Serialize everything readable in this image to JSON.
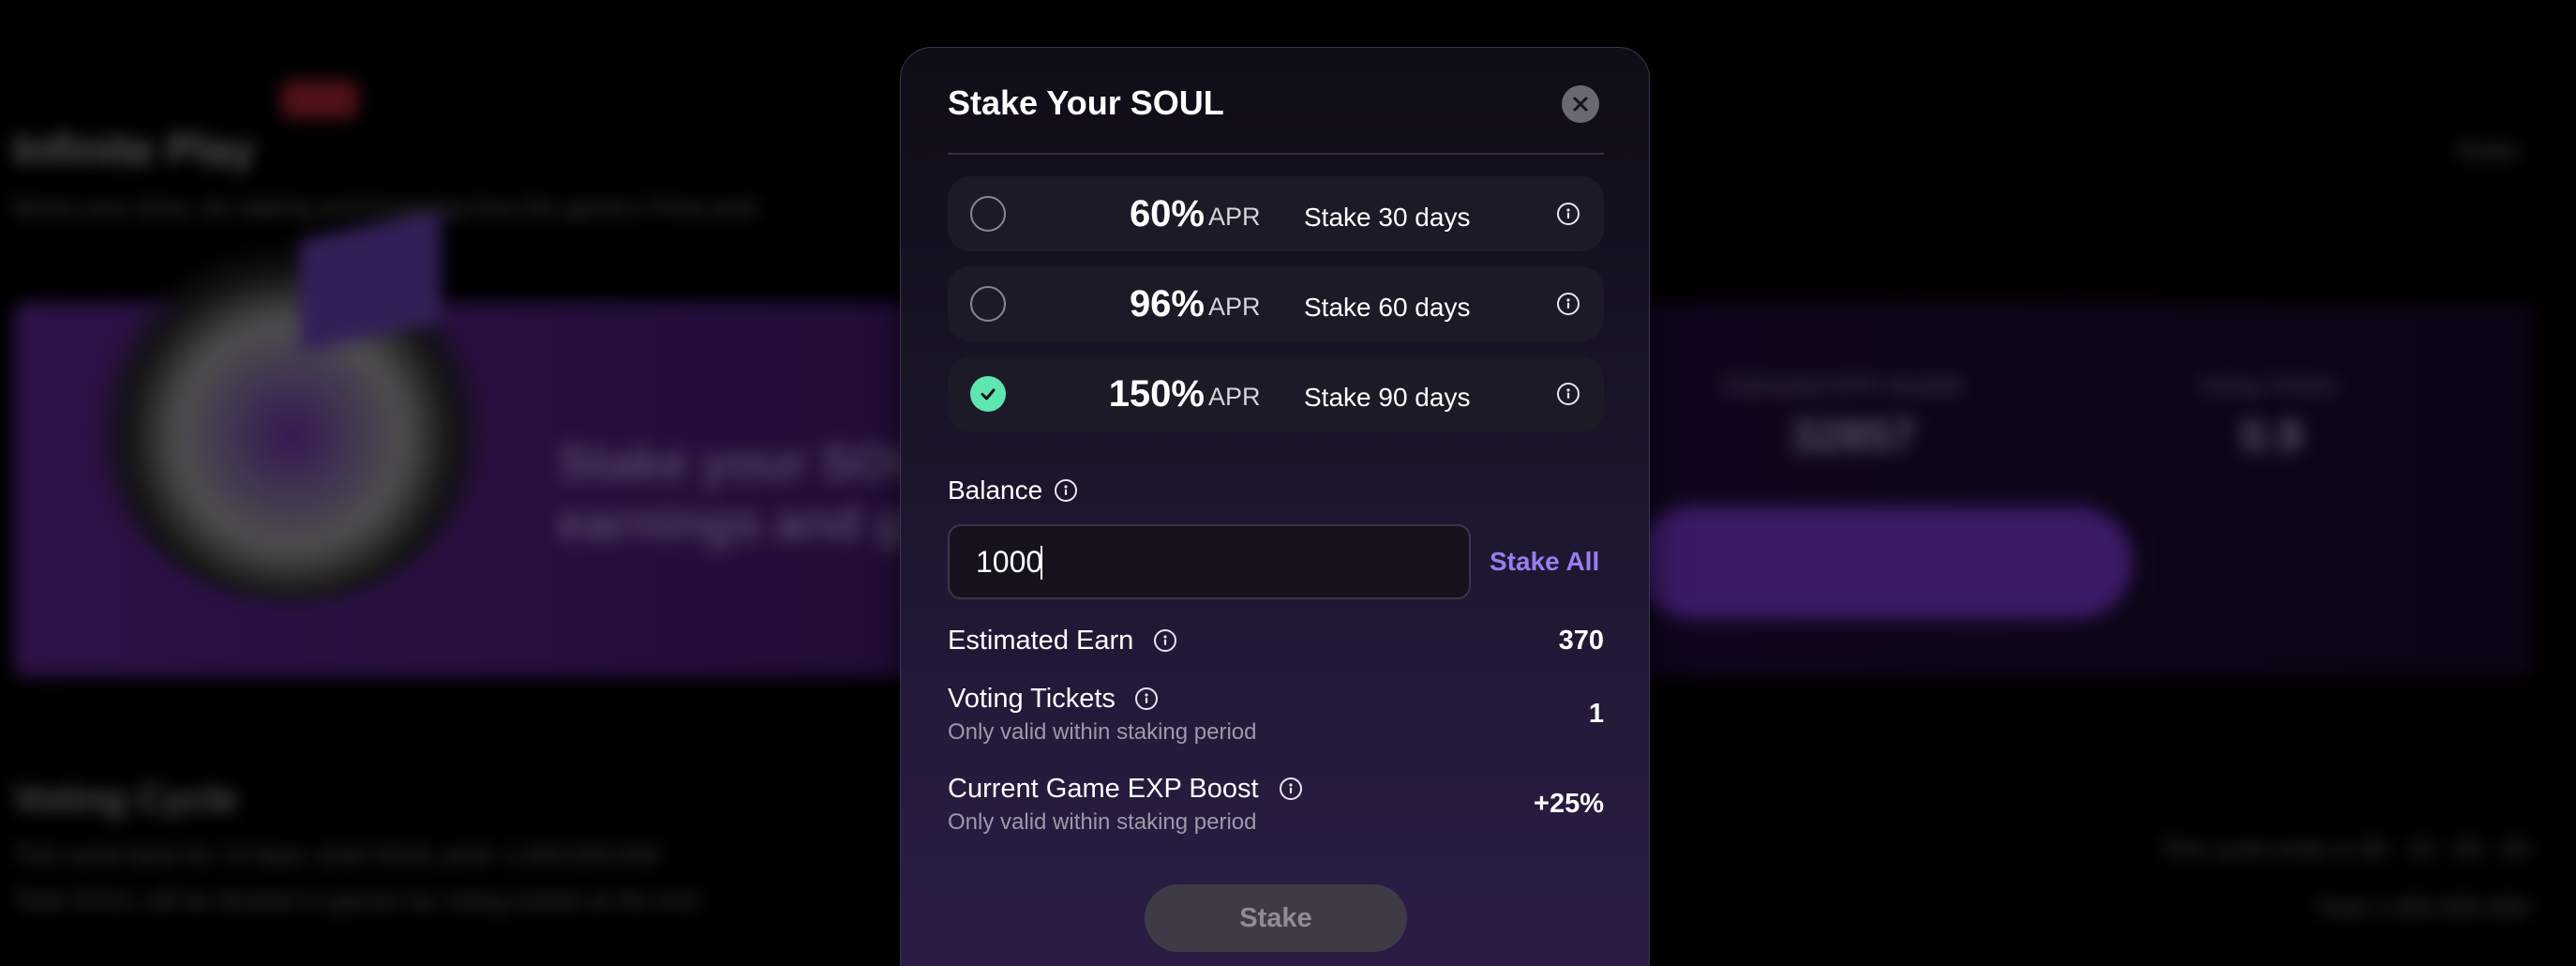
{
  "background": {
    "title": "Infinite Play",
    "subtitle": "Boost your drive, be staking and browsing how the game's Prize pool",
    "rules": "Rules",
    "banner_text_line1": "Stake your SOUL",
    "banner_text_line2": "earnings and gi",
    "stat1_label": "Estimated APR Variable",
    "stat1_value": "32857",
    "stat2_label": "Voting Tickets",
    "stat2_value": "0.9",
    "section_title": "Voting Cycle",
    "section_line1": "This cycle lasts for 14 days, total SOUL pool: 1,000,000,000",
    "section_line2": "Total SOUL will be divided to games by voting tickets at the end",
    "cycle_ends": "This cycle ends in 06 : 15 : 00 : 00",
    "total": "Total 1,000,000,000"
  },
  "modal": {
    "title": "Stake Your SOUL",
    "options": [
      {
        "percent": "60%",
        "apr_label": "APR",
        "days_label": "Stake 30 days",
        "selected": false
      },
      {
        "percent": "96%",
        "apr_label": "APR",
        "days_label": "Stake 60 days",
        "selected": false
      },
      {
        "percent": "150%",
        "apr_label": "APR",
        "days_label": "Stake 90 days",
        "selected": true
      }
    ],
    "balance_label": "Balance",
    "balance_value": "1000",
    "stake_all_label": "Stake All",
    "estimated_earn_label": "Estimated Earn",
    "estimated_earn_value": "370",
    "voting_tickets_label": "Voting Tickets",
    "voting_tickets_sub": "Only valid within staking period",
    "voting_tickets_value": "1",
    "exp_boost_label": "Current Game EXP Boost",
    "exp_boost_sub": "Only valid within staking period",
    "exp_boost_value": "+25%",
    "stake_button_label": "Stake"
  },
  "colors": {
    "accent_purple": "#9a7cf2",
    "selected_green": "#5ee6b0",
    "modal_bg_top": "#0f0d16",
    "modal_bg_bottom": "#2c1d46"
  },
  "icons": [
    "close-icon",
    "info-icon",
    "checkmark-icon"
  ]
}
